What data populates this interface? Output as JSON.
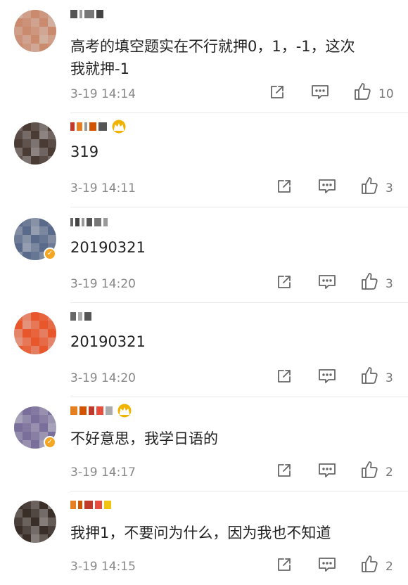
{
  "comments": [
    {
      "username": "",
      "text": "高考的填空题实在不行就押0，1，-1，这次我就押-1",
      "text_line1": "高考的填空题实在不行就押0，1，-1，这次",
      "text_line2": "我就押-1",
      "time": "3-19 14:14",
      "likes": "10",
      "avatar_color": "#c98a6e",
      "verified": false,
      "crown": false
    },
    {
      "username": "",
      "text": "319",
      "time": "3-19 14:11",
      "likes": "3",
      "avatar_color": "#4a3b35",
      "verified": false,
      "crown": true
    },
    {
      "username": "",
      "text": "20190321",
      "time": "3-19 14:20",
      "likes": "3",
      "avatar_color": "#5a6a8a",
      "verified": true,
      "crown": false
    },
    {
      "username": "",
      "text": "20190321",
      "time": "3-19 14:20",
      "likes": "3",
      "avatar_color": "#e8562b",
      "verified": false,
      "crown": false
    },
    {
      "username": "",
      "text": "不好意思，我学日语的",
      "time": "3-19 14:17",
      "likes": "2",
      "avatar_color": "#7a6f9a",
      "verified": true,
      "crown": true
    },
    {
      "username": "",
      "text": "我押1，不要问为什么，因为我也不知道",
      "time": "3-19 14:15",
      "likes": "2",
      "avatar_color": "#3a2e28",
      "verified": false,
      "crown": false
    }
  ],
  "icons": {
    "share": "share-icon",
    "comment": "comment-icon",
    "like": "thumbs-up-icon",
    "verified": "verified-badge-icon",
    "crown": "crown-icon"
  },
  "colors": {
    "text": "#222222",
    "meta": "#888888",
    "divider": "#e8e8e8",
    "verified": "#f5a623",
    "crown": "#f0b400"
  }
}
